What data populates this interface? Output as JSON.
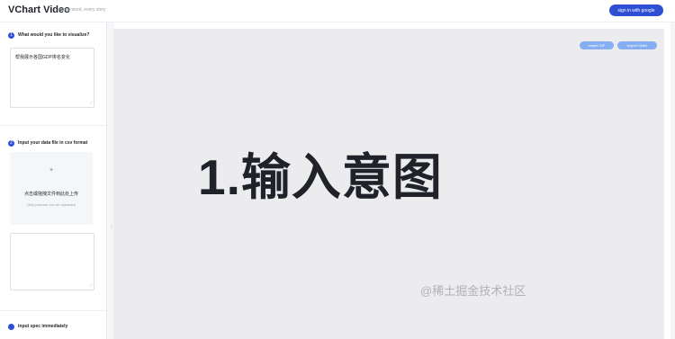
{
  "header": {
    "brand": "VChart Video",
    "slogan": "every word, every story",
    "signin_label": "sign in with google"
  },
  "sidebar": {
    "step1": {
      "number": "1",
      "label": "What would you like to visualize?",
      "value": "帮我展示各国GDP排名变化"
    },
    "step2": {
      "number": "2",
      "label": "Input your data file in csv format",
      "upload_plus": "+",
      "upload_title": "点击或拖拽文件到此处上传",
      "upload_hint": "Only pictures can be uploaded"
    },
    "step3": {
      "label": "input spec immediately"
    }
  },
  "main": {
    "export_gif_label": "export GIF",
    "export_video_label": "export Video",
    "headline": "1.输入意图",
    "watermark": "@稀土掘金技术社区"
  },
  "colors": {
    "accent": "#2e4fd3",
    "pill": "#86aef2",
    "canvas": "#ececee"
  },
  "icons": {
    "splitter_grip": "drag-handle-icon",
    "resize_grip": "resize-grip-icon"
  }
}
